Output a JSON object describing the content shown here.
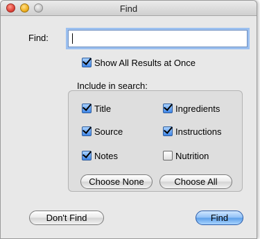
{
  "window": {
    "title": "Find"
  },
  "find": {
    "label": "Find:",
    "value": "",
    "placeholder": ""
  },
  "show_all": {
    "label": "Show All Results at Once",
    "checked": true
  },
  "include": {
    "heading": "Include in search:",
    "options": [
      {
        "label": "Title",
        "checked": true
      },
      {
        "label": "Ingredients",
        "checked": true
      },
      {
        "label": "Source",
        "checked": true
      },
      {
        "label": "Instructions",
        "checked": true
      },
      {
        "label": "Notes",
        "checked": true
      },
      {
        "label": "Nutrition",
        "checked": false
      }
    ],
    "choose_none_label": "Choose None",
    "choose_all_label": "Choose All"
  },
  "buttons": {
    "dont_find_label": "Don't Find",
    "find_label": "Find"
  }
}
